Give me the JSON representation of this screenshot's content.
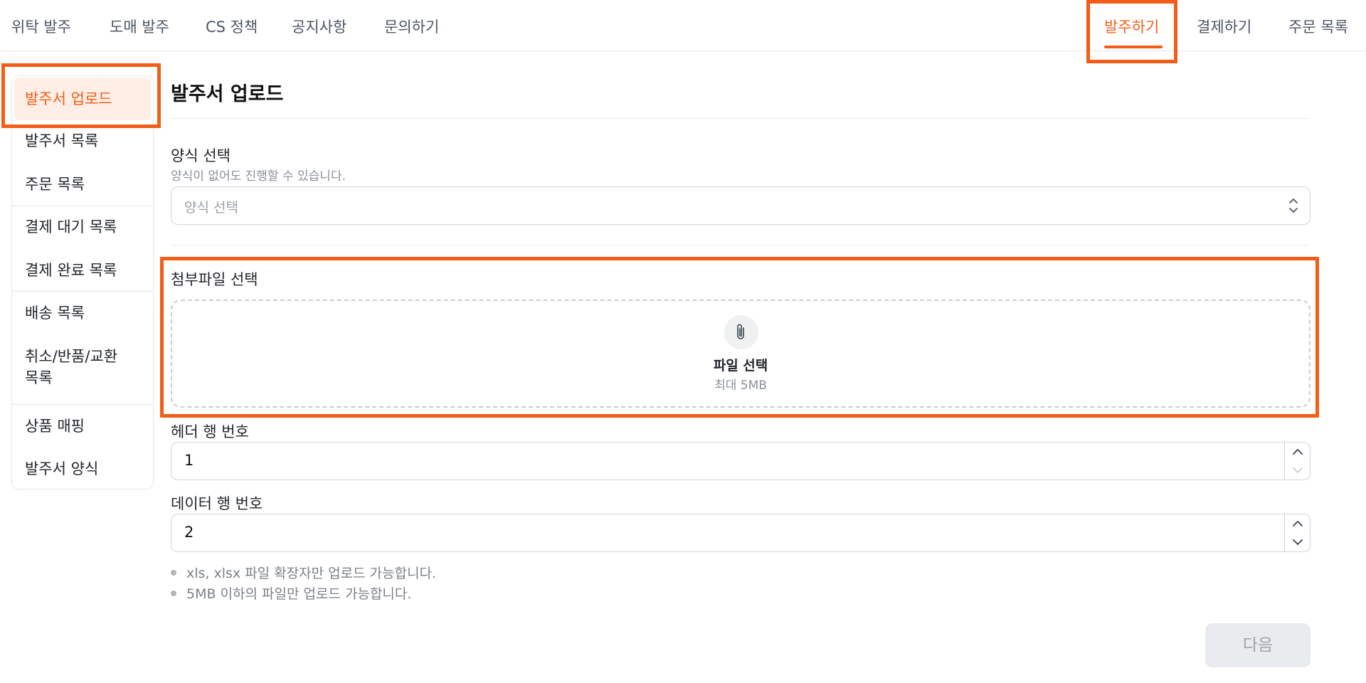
{
  "top_nav": {
    "left_items": [
      "위탁 발주",
      "도매 발주",
      "CS 정책",
      "공지사항",
      "문의하기"
    ],
    "right_items": [
      "발주하기",
      "결제하기",
      "주문 목록"
    ],
    "active": "발주하기"
  },
  "sidebar": {
    "items": [
      "발주서 업로드",
      "발주서 목록",
      "주문 목록",
      "결제 대기 목록",
      "결제 완료 목록",
      "배송 목록",
      "취소/반품/교환",
      "목록",
      "상품 매핑",
      "발주서 양식"
    ],
    "active": "발주서 업로드"
  },
  "main": {
    "title": "발주서 업로드",
    "template": {
      "label": "양식 선택",
      "hint": "양식이 없어도 진행할 수 있습니다.",
      "placeholder": "양식 선택"
    },
    "attachment": {
      "label": "첨부파일 선택",
      "button": "파일 선택",
      "max": "최대 5MB"
    },
    "header_row": {
      "label": "헤더 행 번호",
      "value": "1"
    },
    "data_row": {
      "label": "데이터 행 번호",
      "value": "2"
    },
    "notes": [
      "xls, xlsx 파일 확장자만 업로드 가능합니다.",
      "5MB 이하의 파일만 업로드 가능합니다."
    ],
    "next_button": "다음"
  },
  "colors": {
    "accent": "#f45d18",
    "active_bg": "#feeee6"
  }
}
